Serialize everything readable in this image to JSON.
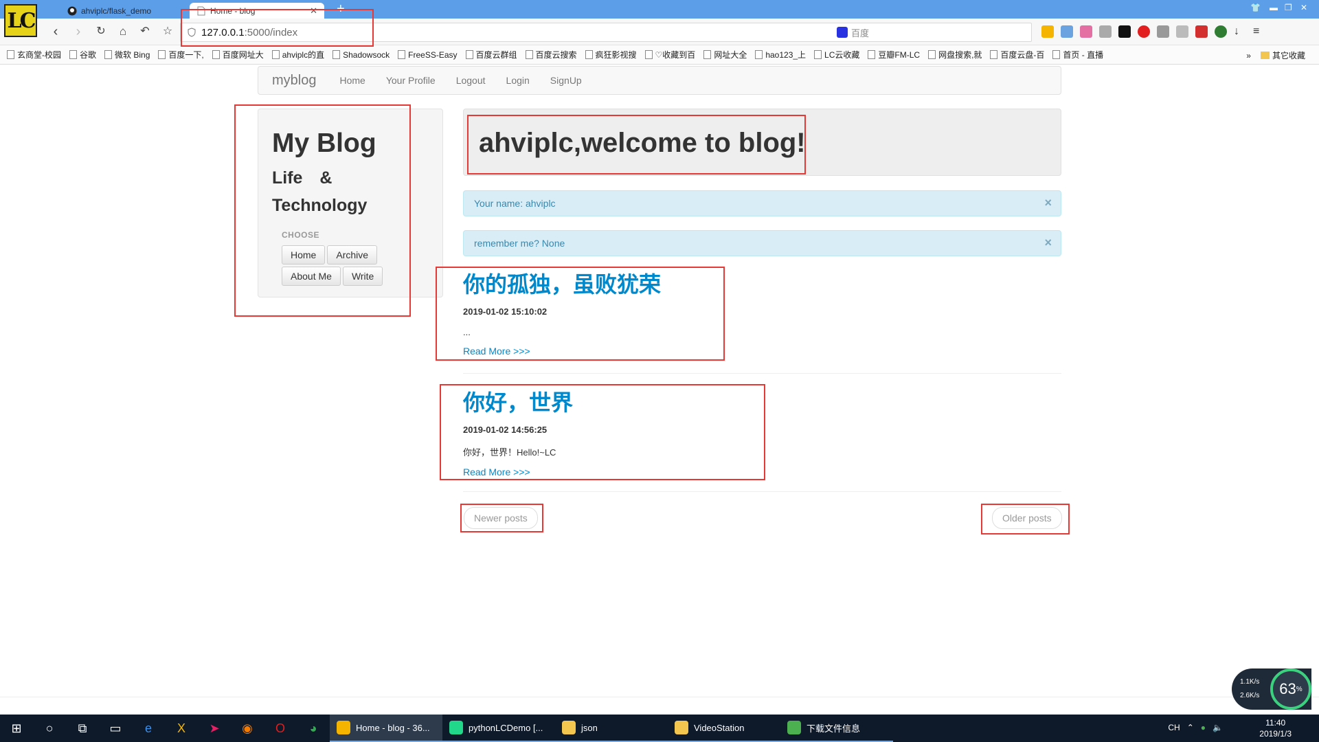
{
  "browser": {
    "tabs": [
      {
        "title": "ahviplc/flask_demo",
        "icon": "github-icon"
      },
      {
        "title": "Home - blog",
        "icon": "page-icon"
      }
    ],
    "address": {
      "host": "127.0.0.1",
      "path": ":5000/index"
    },
    "search_placeholder": "百度",
    "bookmarks": [
      "玄商堂-校园",
      "谷歌",
      "微软 Bing",
      "百度一下,",
      "百度网址大",
      "ahviplc的直",
      "Shadowsock",
      "FreeSS-Easy",
      "百度云群组",
      "百度云搜索",
      "疯狂影视搜",
      "♡收藏到百",
      "网址大全",
      "hao123_上",
      "LC云收藏",
      "豆瓣FM-LC",
      "网盘搜索,就",
      "百度云盘-百",
      "首页 - 直播"
    ],
    "bookmarks_more": "其它收藏"
  },
  "nav": {
    "brand": "myblog",
    "links": [
      "Home",
      "Your Profile",
      "Logout",
      "Login",
      "SignUp"
    ]
  },
  "sidebar": {
    "title": "My Blog",
    "subtitle_line1": "Life &",
    "subtitle_line2": "Technology",
    "choose_label": "CHOOSE",
    "buttons": [
      "Home",
      "Archive",
      "About Me",
      "Write"
    ]
  },
  "jumbotron": {
    "heading": "ahviplc,welcome to blog!"
  },
  "alerts": [
    {
      "text": "Your name: ahviplc",
      "close": "×"
    },
    {
      "text": "remember me? None",
      "close": "×"
    }
  ],
  "posts": [
    {
      "title": "你的孤独，虽败犹荣",
      "date": "2019-01-02 15:10:02",
      "body": "...",
      "more": "Read More >>>"
    },
    {
      "title": "你好，世界",
      "date": "2019-01-02 14:56:25",
      "body": "你好，世界！Hello!~LC",
      "more": "Read More >>>"
    }
  ],
  "pager": {
    "newer": "Newer posts",
    "older": "Older posts"
  },
  "net_speed": {
    "up": "1.1K/s",
    "down": "2.6K/s",
    "percent": "63"
  },
  "taskbar": {
    "apps": [
      {
        "label": "Home - blog - 36...",
        "color": "#f4b400"
      },
      {
        "label": "pythonLCDemo [...",
        "color": "#21d789"
      },
      {
        "label": "json",
        "color": "#f3c74f"
      },
      {
        "label": "VideoStation",
        "color": "#f3c74f"
      },
      {
        "label": "下载文件信息",
        "color": "#4caf50"
      }
    ],
    "ime": "CH",
    "time": "11:40",
    "date": "2019/1/3"
  }
}
